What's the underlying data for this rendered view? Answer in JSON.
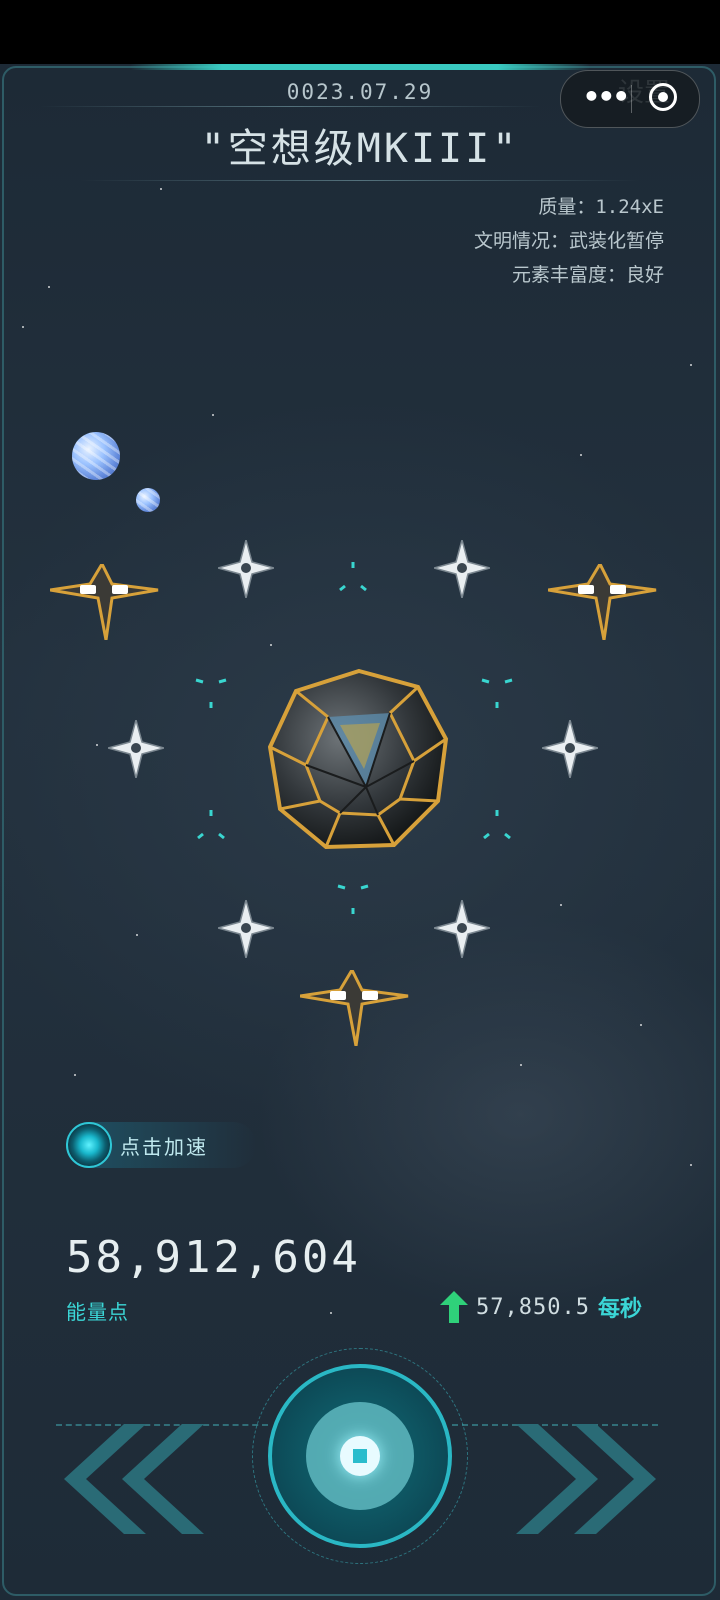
{
  "header": {
    "date": "0023.07.29",
    "title": "\"空想级MKIII\"",
    "settings_label": "设置"
  },
  "capsule": {
    "more_icon": "more-dots-icon",
    "close_icon": "target-circle-icon"
  },
  "info": {
    "mass": "质量：1.24xE",
    "civilization": "文明情况：武装化暂停",
    "elements": "元素丰富度：良好"
  },
  "boost": {
    "label": "点击加速"
  },
  "energy": {
    "value": "58,912,604",
    "label": "能量点",
    "rate_value": "57,850.5",
    "rate_unit": "每秒"
  },
  "colors": {
    "accent": "#3bd6d6",
    "frame": "#2e5c66",
    "gold": "#d7a13a"
  }
}
